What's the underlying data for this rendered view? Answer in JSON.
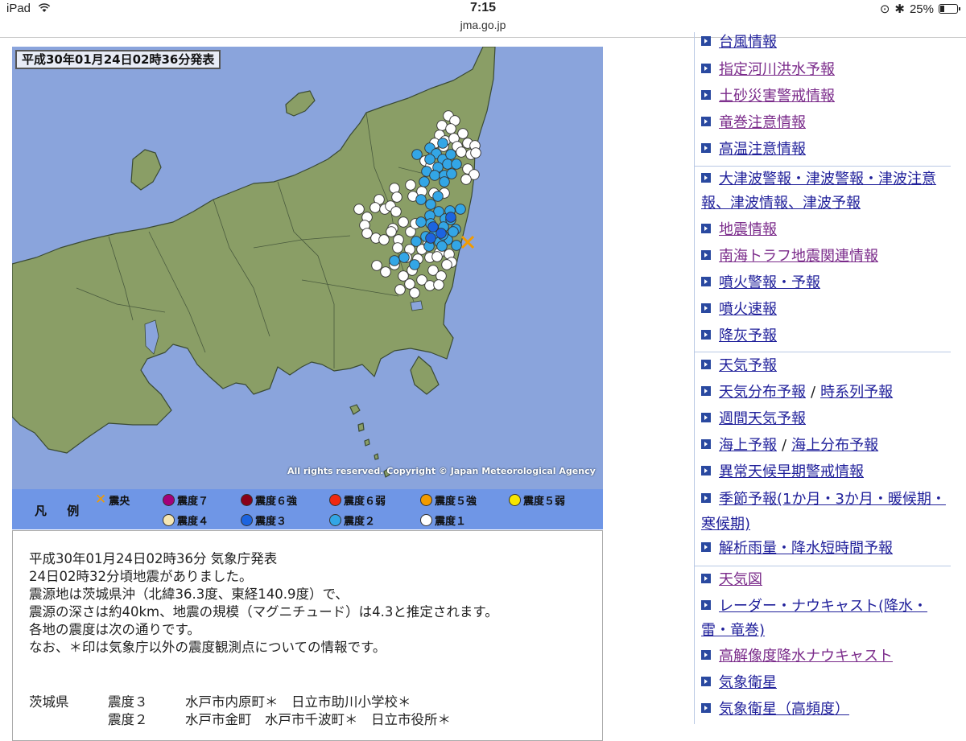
{
  "status_bar": {
    "device": "iPad",
    "time": "7:15",
    "battery": "25%",
    "battery_level": 0.25
  },
  "browser": {
    "url": "jma.go.jp"
  },
  "map": {
    "title": "平成30年01月24日02時36分発表",
    "copyright": "All rights reserved. Copyright © Japan Meteorological Agency",
    "colors": {
      "sea": "#8aa4dc",
      "land": "#8a9e66",
      "intensity1": "#ffffff",
      "intensity2": "#33a6e6",
      "intensity3": "#1c64e0",
      "epicenter": "#f29b00"
    }
  },
  "legend": {
    "label": "凡 例",
    "items": [
      {
        "label": "震央",
        "type": "x",
        "color": "#f29b00"
      },
      {
        "label": "震度７",
        "color": "#a4007a"
      },
      {
        "label": "震度６強",
        "color": "#8a0018"
      },
      {
        "label": "震度６弱",
        "color": "#f02810"
      },
      {
        "label": "震度５強",
        "color": "#f29b00"
      },
      {
        "label": "震度５弱",
        "color": "#f7e600"
      },
      {
        "label": "震度４",
        "color": "#f6e7b4"
      },
      {
        "label": "震度３",
        "color": "#1c64e0"
      },
      {
        "label": "震度２",
        "color": "#33a6e6"
      },
      {
        "label": "震度１",
        "color": "#ffffff"
      }
    ]
  },
  "info": {
    "lines": [
      "平成30年01月24日02時36分 気象庁発表",
      "24日02時32分頃地震がありました。",
      "震源地は茨城県沖（北緯36.3度、東経140.9度）で、",
      "震源の深さは約40km、地震の規模（マグニチュード）は4.3と推定されます。",
      "各地の震度は次の通りです。",
      "なお、＊印は気象庁以外の震度観測点についての情報です。"
    ],
    "rows": [
      {
        "prefecture": "茨城県",
        "level": "震度３",
        "places": "水戸市内原町＊　日立市助川小学校＊"
      },
      {
        "prefecture": "",
        "level": "震度２",
        "places": "水戸市金町　水戸市千波町＊　日立市役所＊"
      }
    ]
  },
  "nav": {
    "items": [
      {
        "label": "台風情報"
      },
      {
        "label": "指定河川洪水予報",
        "visited": true
      },
      {
        "label": "土砂災害警戒情報",
        "visited": true
      },
      {
        "label": "竜巻注意情報",
        "visited": true
      },
      {
        "label": "高温注意情報"
      },
      {
        "label": "大津波警報・津波警報・津波注意報、津波情報、津波予報"
      },
      {
        "label": "地震情報",
        "visited": true
      },
      {
        "label": "南海トラフ地震関連情報",
        "visited": true
      },
      {
        "label": "噴火警報・予報"
      },
      {
        "label": "噴火速報"
      },
      {
        "label": "降灰予報"
      },
      {
        "label": "天気予報"
      },
      {
        "label": "天気分布予報",
        "label2": "時系列予報"
      },
      {
        "label": "週間天気予報"
      },
      {
        "label": "海上予報",
        "label2": "海上分布予報"
      },
      {
        "label": "異常天候早期警戒情報"
      },
      {
        "label": "季節予報(1か月・3か月・暖候期・寒候期)"
      },
      {
        "label": "解析雨量・降水短時間予報"
      },
      {
        "label": "天気図",
        "visited": true
      },
      {
        "label": "レーダー・ナウキャスト(降水・雷・竜巻)"
      },
      {
        "label": "高解像度降水ナウキャスト",
        "visited": true
      },
      {
        "label": "気象衛星"
      },
      {
        "label": "気象衛星（高頻度）"
      }
    ],
    "separator": "/"
  }
}
